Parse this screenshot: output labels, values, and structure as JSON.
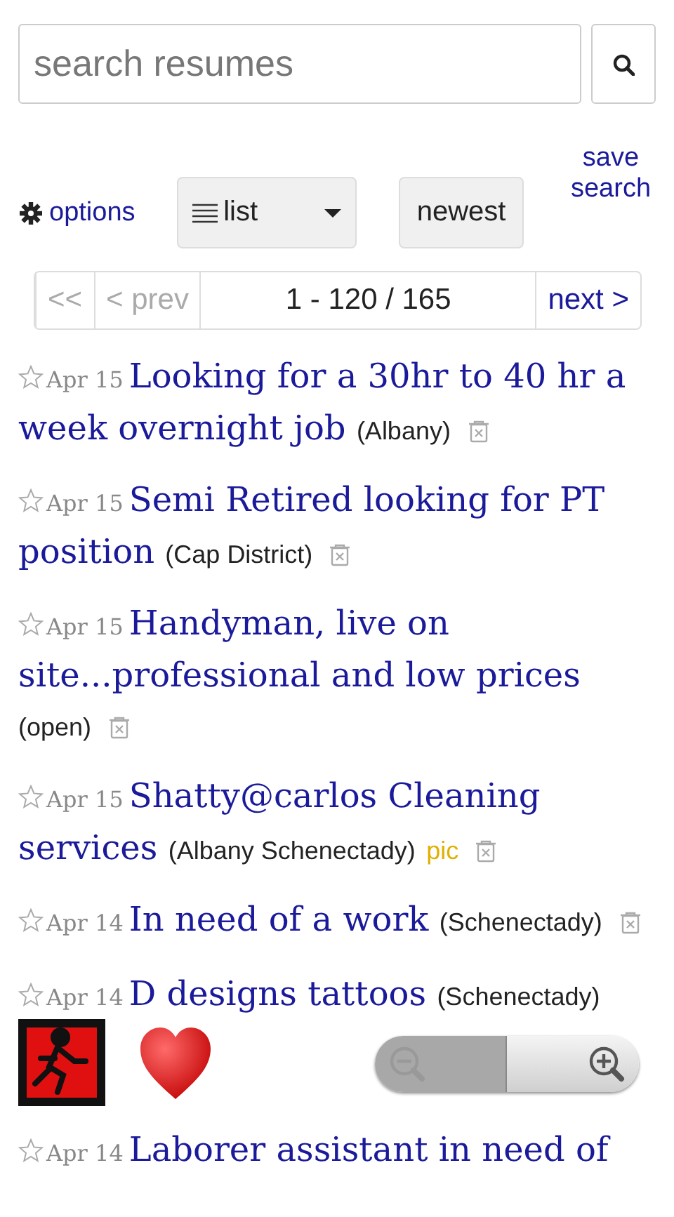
{
  "search": {
    "placeholder": "search resumes"
  },
  "toolbar": {
    "options": "options",
    "view": "list",
    "sort": "newest",
    "save_search": "save search"
  },
  "pager": {
    "first": {
      "label": "<<",
      "disabled": true
    },
    "prev": {
      "label": "< prev",
      "disabled": true
    },
    "range": "1 - 120 / 165",
    "next": {
      "label": "next >",
      "disabled": false
    }
  },
  "posts": [
    {
      "kind": "text",
      "starred": false,
      "date": "Apr 15",
      "title_lines": [
        "Looking for a 30hr to 40 hr a",
        "week overnight job"
      ],
      "location": "(Albany)"
    },
    {
      "kind": "text",
      "starred": false,
      "date": "Apr 15",
      "title_lines": [
        "Semi Retired looking for PT",
        "position"
      ],
      "location": "(Cap District)"
    },
    {
      "kind": "text",
      "starred": false,
      "date": "Apr 15",
      "title_lines": [
        "Handyman, live on",
        "site...professional and low prices"
      ],
      "location": "(open)"
    },
    {
      "kind": "text",
      "starred": false,
      "date": "Apr 15",
      "title_lines": [
        "Shatty@carlos Cleaning",
        "services"
      ],
      "location": "(Albany Schenectady)",
      "pic": "pic"
    },
    {
      "kind": "text",
      "starred": false,
      "date": "Apr 14",
      "title_lines": [
        "In need of a work"
      ],
      "location": "(Schenectady)"
    },
    {
      "kind": "emoji",
      "starred": false,
      "date": "Apr 14",
      "title_lines": [
        "D designs tattoos"
      ],
      "location": "(Schenectady)"
    },
    {
      "kind": "cut",
      "starred": false,
      "date": "Apr 14",
      "title_lines": [
        "Laborer assistant in need of"
      ]
    }
  ],
  "zoom": {
    "zoom_out_disabled": true
  }
}
